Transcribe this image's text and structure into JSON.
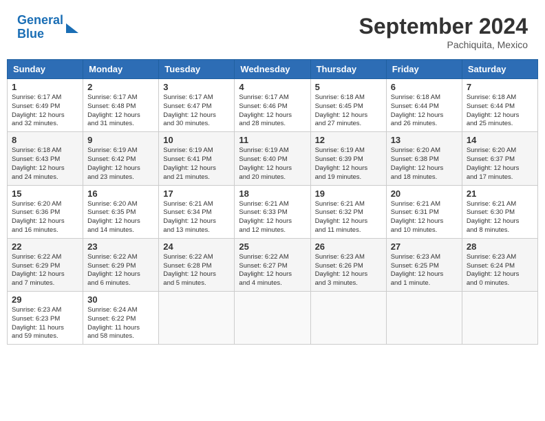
{
  "header": {
    "logo_line1": "General",
    "logo_line2": "Blue",
    "title": "September 2024",
    "location": "Pachiquita, Mexico"
  },
  "weekdays": [
    "Sunday",
    "Monday",
    "Tuesday",
    "Wednesday",
    "Thursday",
    "Friday",
    "Saturday"
  ],
  "weeks": [
    [
      {
        "day": "1",
        "info": "Sunrise: 6:17 AM\nSunset: 6:49 PM\nDaylight: 12 hours\nand 32 minutes."
      },
      {
        "day": "2",
        "info": "Sunrise: 6:17 AM\nSunset: 6:48 PM\nDaylight: 12 hours\nand 31 minutes."
      },
      {
        "day": "3",
        "info": "Sunrise: 6:17 AM\nSunset: 6:47 PM\nDaylight: 12 hours\nand 30 minutes."
      },
      {
        "day": "4",
        "info": "Sunrise: 6:17 AM\nSunset: 6:46 PM\nDaylight: 12 hours\nand 28 minutes."
      },
      {
        "day": "5",
        "info": "Sunrise: 6:18 AM\nSunset: 6:45 PM\nDaylight: 12 hours\nand 27 minutes."
      },
      {
        "day": "6",
        "info": "Sunrise: 6:18 AM\nSunset: 6:44 PM\nDaylight: 12 hours\nand 26 minutes."
      },
      {
        "day": "7",
        "info": "Sunrise: 6:18 AM\nSunset: 6:44 PM\nDaylight: 12 hours\nand 25 minutes."
      }
    ],
    [
      {
        "day": "8",
        "info": "Sunrise: 6:18 AM\nSunset: 6:43 PM\nDaylight: 12 hours\nand 24 minutes."
      },
      {
        "day": "9",
        "info": "Sunrise: 6:19 AM\nSunset: 6:42 PM\nDaylight: 12 hours\nand 23 minutes."
      },
      {
        "day": "10",
        "info": "Sunrise: 6:19 AM\nSunset: 6:41 PM\nDaylight: 12 hours\nand 21 minutes."
      },
      {
        "day": "11",
        "info": "Sunrise: 6:19 AM\nSunset: 6:40 PM\nDaylight: 12 hours\nand 20 minutes."
      },
      {
        "day": "12",
        "info": "Sunrise: 6:19 AM\nSunset: 6:39 PM\nDaylight: 12 hours\nand 19 minutes."
      },
      {
        "day": "13",
        "info": "Sunrise: 6:20 AM\nSunset: 6:38 PM\nDaylight: 12 hours\nand 18 minutes."
      },
      {
        "day": "14",
        "info": "Sunrise: 6:20 AM\nSunset: 6:37 PM\nDaylight: 12 hours\nand 17 minutes."
      }
    ],
    [
      {
        "day": "15",
        "info": "Sunrise: 6:20 AM\nSunset: 6:36 PM\nDaylight: 12 hours\nand 16 minutes."
      },
      {
        "day": "16",
        "info": "Sunrise: 6:20 AM\nSunset: 6:35 PM\nDaylight: 12 hours\nand 14 minutes."
      },
      {
        "day": "17",
        "info": "Sunrise: 6:21 AM\nSunset: 6:34 PM\nDaylight: 12 hours\nand 13 minutes."
      },
      {
        "day": "18",
        "info": "Sunrise: 6:21 AM\nSunset: 6:33 PM\nDaylight: 12 hours\nand 12 minutes."
      },
      {
        "day": "19",
        "info": "Sunrise: 6:21 AM\nSunset: 6:32 PM\nDaylight: 12 hours\nand 11 minutes."
      },
      {
        "day": "20",
        "info": "Sunrise: 6:21 AM\nSunset: 6:31 PM\nDaylight: 12 hours\nand 10 minutes."
      },
      {
        "day": "21",
        "info": "Sunrise: 6:21 AM\nSunset: 6:30 PM\nDaylight: 12 hours\nand 8 minutes."
      }
    ],
    [
      {
        "day": "22",
        "info": "Sunrise: 6:22 AM\nSunset: 6:29 PM\nDaylight: 12 hours\nand 7 minutes."
      },
      {
        "day": "23",
        "info": "Sunrise: 6:22 AM\nSunset: 6:29 PM\nDaylight: 12 hours\nand 6 minutes."
      },
      {
        "day": "24",
        "info": "Sunrise: 6:22 AM\nSunset: 6:28 PM\nDaylight: 12 hours\nand 5 minutes."
      },
      {
        "day": "25",
        "info": "Sunrise: 6:22 AM\nSunset: 6:27 PM\nDaylight: 12 hours\nand 4 minutes."
      },
      {
        "day": "26",
        "info": "Sunrise: 6:23 AM\nSunset: 6:26 PM\nDaylight: 12 hours\nand 3 minutes."
      },
      {
        "day": "27",
        "info": "Sunrise: 6:23 AM\nSunset: 6:25 PM\nDaylight: 12 hours\nand 1 minute."
      },
      {
        "day": "28",
        "info": "Sunrise: 6:23 AM\nSunset: 6:24 PM\nDaylight: 12 hours\nand 0 minutes."
      }
    ],
    [
      {
        "day": "29",
        "info": "Sunrise: 6:23 AM\nSunset: 6:23 PM\nDaylight: 11 hours\nand 59 minutes."
      },
      {
        "day": "30",
        "info": "Sunrise: 6:24 AM\nSunset: 6:22 PM\nDaylight: 11 hours\nand 58 minutes."
      },
      {
        "day": "",
        "info": ""
      },
      {
        "day": "",
        "info": ""
      },
      {
        "day": "",
        "info": ""
      },
      {
        "day": "",
        "info": ""
      },
      {
        "day": "",
        "info": ""
      }
    ]
  ]
}
